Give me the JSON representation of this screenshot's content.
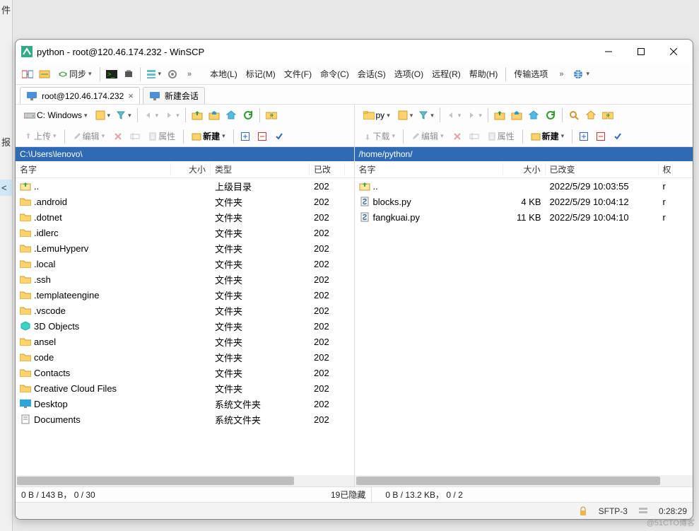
{
  "sidecrop": {
    "l1": "件",
    "l2": "报",
    "l3": "<"
  },
  "title": "python - root@120.46.174.232 - WinSCP",
  "toolbar1": {
    "sync": "同步",
    "more": "»"
  },
  "menus": [
    "本地(L)",
    "标记(M)",
    "文件(F)",
    "命令(C)",
    "会话(S)",
    "选项(O)",
    "远程(R)",
    "帮助(H)"
  ],
  "transfer_opts": "传输选项",
  "tabs": {
    "session": "root@120.46.174.232",
    "new": "新建会话"
  },
  "left": {
    "drive": "C: Windows",
    "actions": {
      "upload": "上传",
      "edit": "编辑",
      "props": "属性",
      "new": "新建"
    },
    "path": "C:\\Users\\lenovo\\",
    "headers": {
      "name": "名字",
      "size": "大小",
      "type": "类型",
      "date": "已改"
    },
    "rows": [
      {
        "icon": "up",
        "name": "..",
        "type": "上级目录",
        "date": "202"
      },
      {
        "icon": "folder",
        "name": ".android",
        "type": "文件夹",
        "date": "202"
      },
      {
        "icon": "folder",
        "name": ".dotnet",
        "type": "文件夹",
        "date": "202"
      },
      {
        "icon": "folder",
        "name": ".idlerc",
        "type": "文件夹",
        "date": "202"
      },
      {
        "icon": "folder",
        "name": ".LemuHyperv",
        "type": "文件夹",
        "date": "202"
      },
      {
        "icon": "folder",
        "name": ".local",
        "type": "文件夹",
        "date": "202"
      },
      {
        "icon": "folder",
        "name": ".ssh",
        "type": "文件夹",
        "date": "202"
      },
      {
        "icon": "folder",
        "name": ".templateengine",
        "type": "文件夹",
        "date": "202"
      },
      {
        "icon": "folder",
        "name": ".vscode",
        "type": "文件夹",
        "date": "202"
      },
      {
        "icon": "cube",
        "name": "3D Objects",
        "type": "文件夹",
        "date": "202"
      },
      {
        "icon": "folder",
        "name": "ansel",
        "type": "文件夹",
        "date": "202"
      },
      {
        "icon": "folder",
        "name": "code",
        "type": "文件夹",
        "date": "202"
      },
      {
        "icon": "folder",
        "name": "Contacts",
        "type": "文件夹",
        "date": "202"
      },
      {
        "icon": "folder",
        "name": "Creative Cloud Files",
        "type": "文件夹",
        "date": "202"
      },
      {
        "icon": "desktop",
        "name": "Desktop",
        "type": "系统文件夹",
        "date": "202"
      },
      {
        "icon": "docs",
        "name": "Documents",
        "type": "系统文件夹",
        "date": "202"
      }
    ],
    "status_left": "0 B / 143 B，  0 / 30",
    "status_right": "19已隐藏"
  },
  "right": {
    "drive": "py",
    "actions": {
      "download": "下载",
      "edit": "编辑",
      "props": "属性",
      "new": "新建"
    },
    "path": "/home/python/",
    "headers": {
      "name": "名字",
      "size": "大小",
      "date": "已改变",
      "perm": "权"
    },
    "rows": [
      {
        "icon": "up",
        "name": "..",
        "size": "",
        "date": "2022/5/29 10:03:55",
        "perm": "r"
      },
      {
        "icon": "py",
        "name": "blocks.py",
        "size": "4 KB",
        "date": "2022/5/29 10:04:12",
        "perm": "r"
      },
      {
        "icon": "py",
        "name": "fangkuai.py",
        "size": "11 KB",
        "date": "2022/5/29 10:04:10",
        "perm": "r"
      }
    ],
    "status": "0 B / 13.2 KB，  0 / 2"
  },
  "bottom": {
    "proto": "SFTP-3",
    "time": "0:28:29"
  },
  "watermark": "@51CTO博客"
}
